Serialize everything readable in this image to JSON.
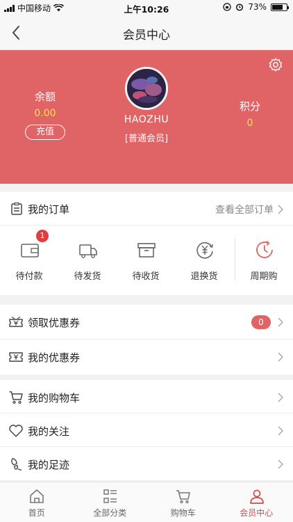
{
  "status_bar": {
    "carrier": "中国移动",
    "time": "上午10:26",
    "battery": "73%",
    "battery_level": 0.73
  },
  "nav": {
    "title": "会员中心"
  },
  "profile": {
    "balance_label": "余额",
    "balance_value": "0.00",
    "recharge_label": "充值",
    "username": "HAOZHU",
    "member_level": "[普通会员]",
    "points_label": "积分",
    "points_value": "0"
  },
  "orders": {
    "title": "我的订单",
    "view_all": "查看全部订单",
    "items": [
      {
        "label": "待付款",
        "icon": "wallet-icon",
        "badge": "1"
      },
      {
        "label": "待发货",
        "icon": "truck-icon"
      },
      {
        "label": "待收货",
        "icon": "box-icon"
      },
      {
        "label": "退换货",
        "icon": "refund-icon"
      },
      {
        "label": "周期购",
        "icon": "cycle-icon"
      }
    ]
  },
  "coupons": {
    "get_label": "领取优惠券",
    "get_count": "0",
    "mine_label": "我的优惠券"
  },
  "menu": {
    "cart_label": "我的购物车",
    "follow_label": "我的关注",
    "footprint_label": "我的足迹"
  },
  "tabs": [
    {
      "label": "首页",
      "icon": "home-icon"
    },
    {
      "label": "全部分类",
      "icon": "category-icon"
    },
    {
      "label": "购物车",
      "icon": "cart-icon"
    },
    {
      "label": "会员中心",
      "icon": "user-icon",
      "active": true
    }
  ],
  "colors": {
    "accent": "#e06466",
    "value_yellow": "#f7e14a",
    "active_tab": "#d8474a"
  }
}
